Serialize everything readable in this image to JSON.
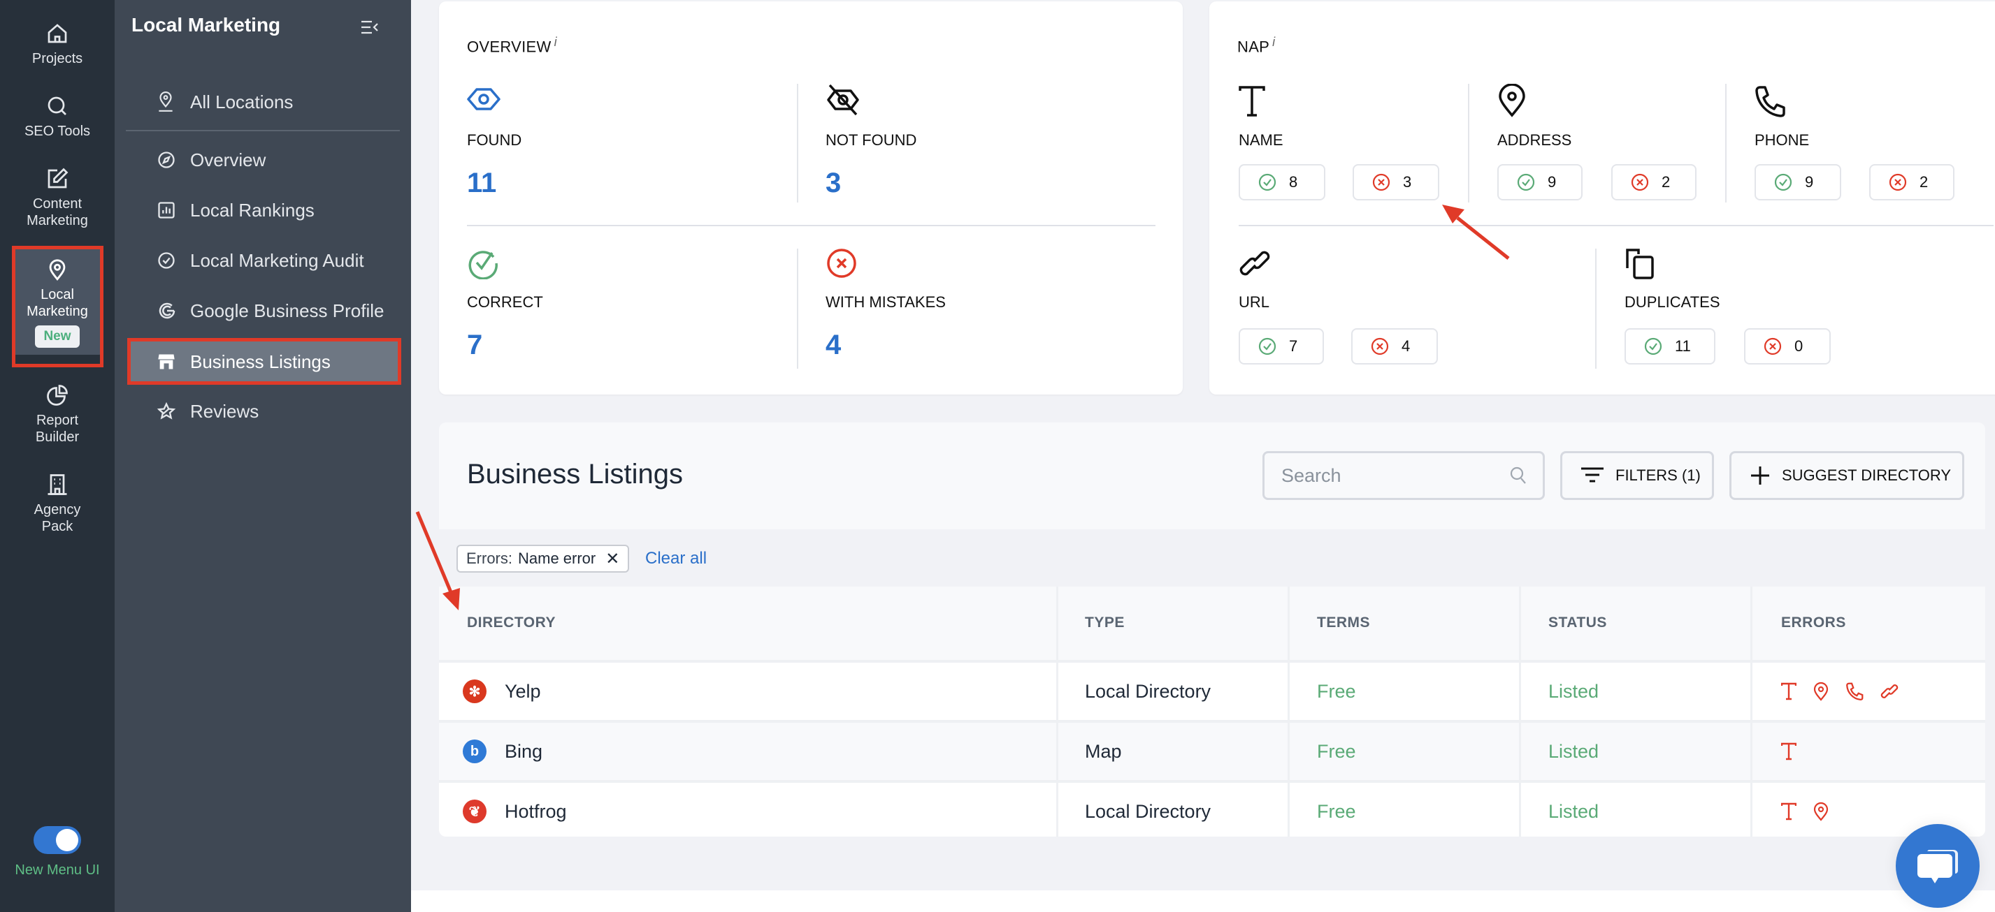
{
  "rail": {
    "items": [
      {
        "label": "Projects",
        "icon": "home-icon"
      },
      {
        "label": "SEO Tools",
        "icon": "search-icon"
      },
      {
        "label": "Content Marketing",
        "icon": "edit-icon"
      },
      {
        "label": "Local Marketing",
        "icon": "map-pin-icon",
        "badge": "New",
        "active": true
      },
      {
        "label": "Report Builder",
        "icon": "pie-chart-icon"
      },
      {
        "label": "Agency Pack",
        "icon": "building-icon"
      }
    ],
    "toggle": {
      "label": "New Menu UI",
      "on": true
    }
  },
  "sidebar": {
    "title": "Local Marketing",
    "items": [
      {
        "label": "All Locations",
        "icon": "map-pin-icon"
      },
      {
        "label": "Overview",
        "icon": "compass-icon"
      },
      {
        "label": "Local Rankings",
        "icon": "bar-chart-icon"
      },
      {
        "label": "Local Marketing Audit",
        "icon": "check-circle-icon"
      },
      {
        "label": "Google Business Profile",
        "icon": "google-icon"
      },
      {
        "label": "Business Listings",
        "icon": "store-icon",
        "active": true
      },
      {
        "label": "Reviews",
        "icon": "star-icon",
        "expandable": true
      }
    ]
  },
  "overview": {
    "title": "OVERVIEW",
    "info": "i",
    "stats": [
      {
        "label": "FOUND",
        "value": "11",
        "icon": "eye-icon"
      },
      {
        "label": "NOT FOUND",
        "value": "3",
        "icon": "eye-off-icon"
      },
      {
        "label": "CORRECT",
        "value": "7",
        "icon": "check-circle-icon"
      },
      {
        "label": "WITH MISTAKES",
        "value": "4",
        "icon": "x-circle-icon"
      }
    ]
  },
  "nap": {
    "title": "NAP",
    "info": "i",
    "groups": [
      {
        "label": "NAME",
        "icon": "text-icon",
        "ok": "8",
        "err": "3"
      },
      {
        "label": "ADDRESS",
        "icon": "map-pin-icon",
        "ok": "9",
        "err": "2"
      },
      {
        "label": "PHONE",
        "icon": "phone-icon",
        "ok": "9",
        "err": "2"
      },
      {
        "label": "URL",
        "icon": "link-icon",
        "ok": "7",
        "err": "4"
      },
      {
        "label": "DUPLICATES",
        "icon": "copy-icon",
        "ok": "11",
        "err": "0"
      }
    ]
  },
  "listings": {
    "title": "Business Listings",
    "search_placeholder": "Search",
    "filters_label": "FILTERS (1)",
    "suggest_label": "SUGGEST DIRECTORY",
    "chip": {
      "key": "Errors:",
      "value": "Name error"
    },
    "clear_all": "Clear all",
    "columns": [
      "DIRECTORY",
      "TYPE",
      "TERMS",
      "STATUS",
      "ERRORS"
    ],
    "rows": [
      {
        "directory": "Yelp",
        "logo_color": "#d9381e",
        "type": "Local Directory",
        "terms": "Free",
        "status": "Listed",
        "errors": [
          "text-icon",
          "map-pin-icon",
          "phone-icon",
          "link-icon"
        ]
      },
      {
        "directory": "Bing",
        "logo_color": "#2f7ad6",
        "type": "Map",
        "terms": "Free",
        "status": "Listed",
        "errors": [
          "text-icon"
        ]
      },
      {
        "directory": "Hotfrog",
        "logo_color": "#de3a2c",
        "type": "Local Directory",
        "terms": "Free",
        "status": "Listed",
        "errors": [
          "text-icon",
          "map-pin-icon"
        ]
      }
    ]
  },
  "colors": {
    "accent": "#2a6fc9",
    "success": "#5aaa76",
    "error": "#e03a28",
    "annotation": "#e03a28"
  }
}
